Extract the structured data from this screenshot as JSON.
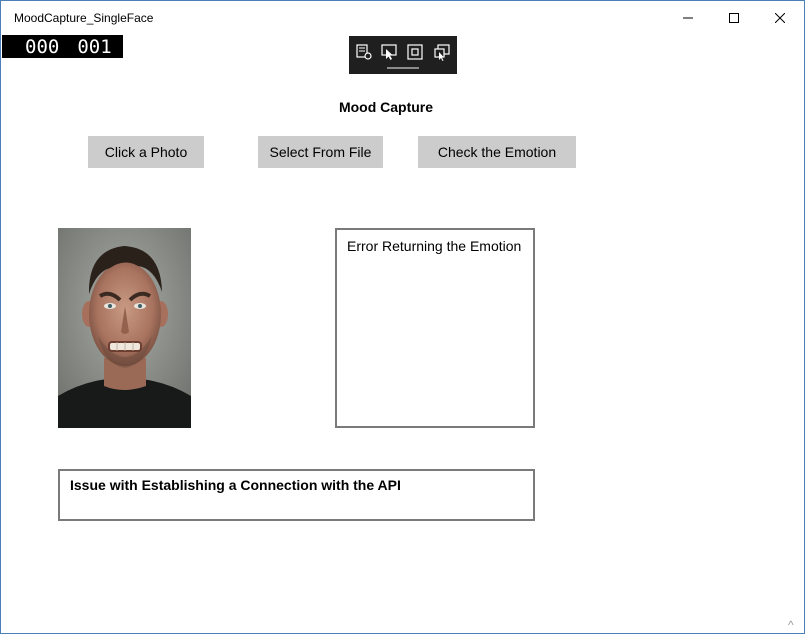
{
  "window": {
    "title": "MoodCapture_SingleFace"
  },
  "frame_counter": {
    "left": "000",
    "right": "001"
  },
  "debug_toolbar": {
    "icons": [
      "select-element-icon",
      "select-pointer-icon",
      "layout-bounds-icon",
      "live-preview-icon"
    ]
  },
  "page": {
    "title": "Mood Capture"
  },
  "actions": {
    "click_photo": "Click a Photo",
    "select_file": "Select From File",
    "check_emotion": "Check the Emotion"
  },
  "emotion_result": {
    "text": "Error Returning the Emotion"
  },
  "status": {
    "message": "Issue with Establishing a Connection with the API"
  },
  "scroll_indicator": "^",
  "colors": {
    "window_border": "#4a7fb8",
    "button_bg": "#cccccc",
    "box_border": "#7a7a7a",
    "toolbar_bg": "#1f1f1f",
    "counter_bg": "#000000"
  }
}
